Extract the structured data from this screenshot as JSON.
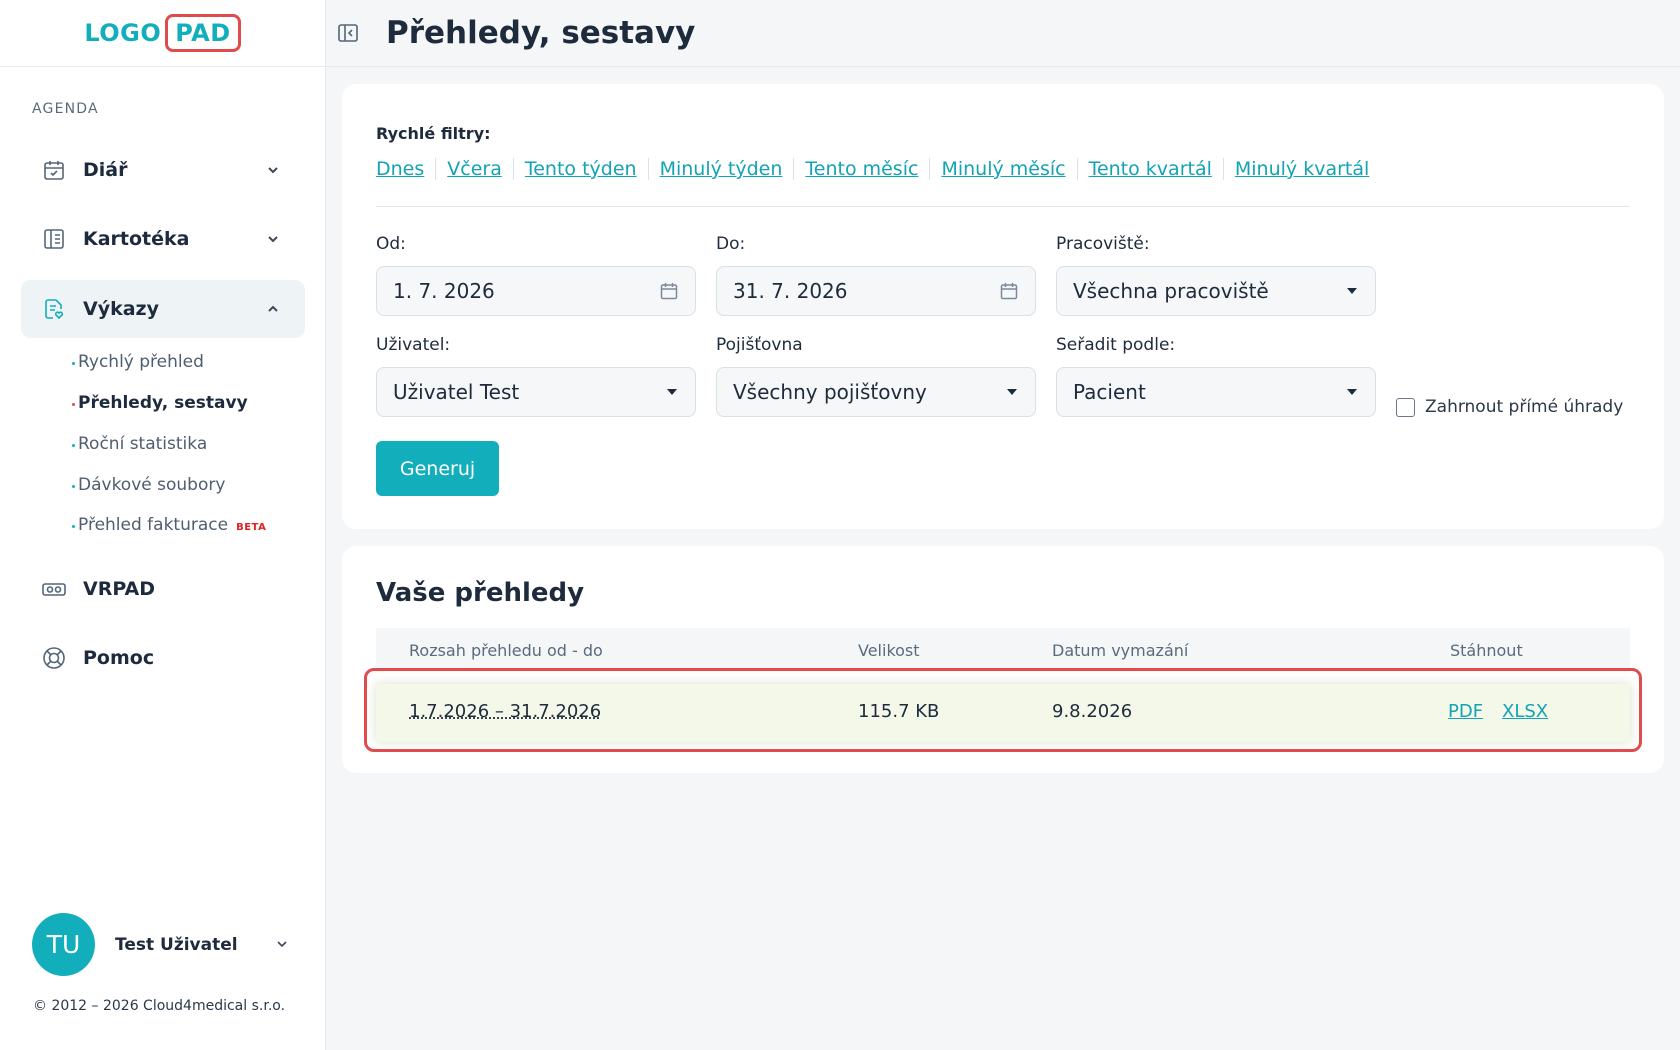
{
  "logo": {
    "part1": "LOGO",
    "part2": "PAD"
  },
  "sidebar": {
    "section_label": "AGENDA",
    "items": [
      {
        "label": "Diář"
      },
      {
        "label": "Kartotéka"
      },
      {
        "label": "Výkazy"
      },
      {
        "label": "VRPAD"
      },
      {
        "label": "Pomoc"
      }
    ],
    "subitems": [
      {
        "label": "Rychlý přehled"
      },
      {
        "label": "Přehledy, sestavy"
      },
      {
        "label": "Roční statistika"
      },
      {
        "label": "Dávkové soubory"
      },
      {
        "label": "Přehled fakturace",
        "badge": "BETA"
      }
    ],
    "user": {
      "initials": "TU",
      "name": "Test Uživatel"
    },
    "copyright": "© 2012 – 2026 Cloud4medical s.r.o."
  },
  "header": {
    "title": "Přehledy, sestavy"
  },
  "filters": {
    "quick_label": "Rychlé filtry:",
    "quick_links": [
      "Dnes",
      "Včera",
      "Tento týden",
      "Minulý týden",
      "Tento měsíc",
      "Minulý měsíc",
      "Tento kvartál",
      "Minulý kvartál"
    ],
    "from": {
      "label": "Od:",
      "value": "1. 7. 2026"
    },
    "to": {
      "label": "Do:",
      "value": "31. 7. 2026"
    },
    "workplace": {
      "label": "Pracoviště:",
      "value": "Všechna pracoviště"
    },
    "user": {
      "label": "Uživatel:",
      "value": "Uživatel Test"
    },
    "insurer": {
      "label": "Pojišťovna",
      "value": "Všechny pojišťovny"
    },
    "sort": {
      "label": "Seřadit podle:",
      "value": "Pacient"
    },
    "direct_payments_label": "Zahrnout přímé úhrady",
    "generate_label": "Generuj"
  },
  "reports": {
    "title": "Vaše přehledy",
    "columns": {
      "range": "Rozsah přehledu od - do",
      "size": "Velikost",
      "deletion": "Datum vymazání",
      "download": "Stáhnout"
    },
    "rows": [
      {
        "range": "1.7.2026 – 31.7.2026",
        "size": "115.7 KB",
        "deletion": "9.8.2026",
        "pdf": "PDF",
        "xlsx": "XLSX"
      }
    ]
  },
  "colors": {
    "accent": "#13aebc",
    "highlight_border": "#e04b4b",
    "row_bg": "#f3f8e9"
  }
}
